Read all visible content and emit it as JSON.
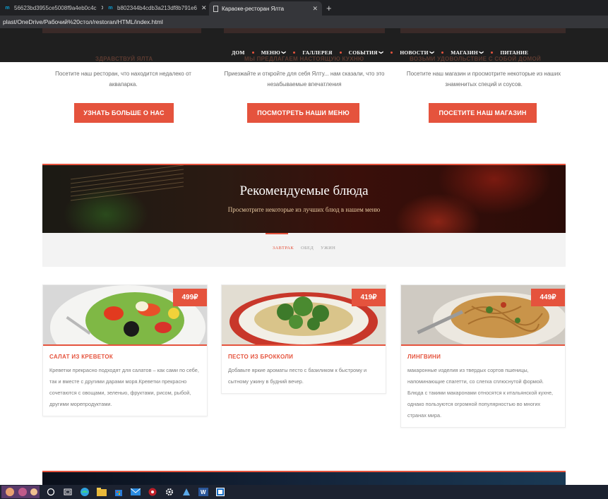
{
  "browser": {
    "tabs": [
      {
        "label": "56623bd3955ce5008f9a4eb0c4c",
        "icon": "mj-favicon"
      },
      {
        "label": "b802344b4cdb3a213df8b791e6",
        "icon": "mj-favicon"
      },
      {
        "label": "Караоке-ресторан Ялта",
        "icon": "page-icon"
      }
    ],
    "address": "plast/OneDrive/Рабочий%20стол/restoran/HTML/index.html"
  },
  "nav": {
    "items": [
      {
        "label": "ДОМ",
        "dropdown": false
      },
      {
        "label": "МЕНЮ",
        "dropdown": true
      },
      {
        "label": "ГАЛЛЕРЕЯ",
        "dropdown": false
      },
      {
        "label": "СОБЫТИЯ",
        "dropdown": true
      },
      {
        "label": "НОВОСТИ",
        "dropdown": true
      },
      {
        "label": "МАГАЗИН",
        "dropdown": true
      },
      {
        "label": "ПИТАНИЕ",
        "dropdown": false
      }
    ],
    "accent": "#e5533d",
    "ghost_titles": [
      "ЗДРАВСТВУЙ ЯЛТА",
      "МЫ ПРЕДЛАГАЕМ НАСТОЯЩУЮ КУХНЮ",
      "ВОЗЬМИ УДОВОЛЬСТВИЕ С СОБОЙ ДОМОЙ"
    ]
  },
  "intro": [
    {
      "text": "Посетите наш ресторан, что находится недалеко от аквапарка.",
      "button": "УЗНАТЬ БОЛЬШЕ О НАС"
    },
    {
      "text": "Приезжайте и откройте для себя Ялту... нам сказали, что это незабываемые впечатления",
      "button": "ПОСМОТРЕТЬ НАШИ МЕНЮ"
    },
    {
      "text": "Посетите наш магазин и просмотрите некоторые из наших знаменитых специй и соусов.",
      "button": "ПОСЕТИТЕ НАШ МАГАЗИН"
    }
  ],
  "featured": {
    "title": "Рекомендуемые блюда",
    "subtitle": "Просмотрите некоторые из лучших блюд в нашем меню",
    "tabs": [
      "ЗАВТРАК",
      "ОБЕД",
      "УЖИН"
    ],
    "active_tab": "ЗАВТРАК"
  },
  "dishes": [
    {
      "name": "САЛАТ ИЗ КРЕВЕТОК",
      "price": "499₽",
      "description": "Креветки прекрасно подходят для салатов – как сами по себе, так и вместе с другими дарами моря.Креветки прекрасно сочетаются с овощами, зеленью, фруктами, рисом, рыбой, другими морепродуктами."
    },
    {
      "name": "ПЕСТО ИЗ БРОККОЛИ",
      "price": "419₽",
      "description": "Добавьте яркие ароматы песто с базиликом к быстрому и сытному ужину в будний вечер."
    },
    {
      "name": "ЛИНГВИНИ",
      "price": "449₽",
      "description": "макаронные изделия из твердых сортов пшеницы, напоминающие спагетти, со слегка сплюснутой формой. Блюда с такими макаронами относятся к итальянской кухне, однако пользуются огромной популярностью во многих странах мира."
    }
  ]
}
